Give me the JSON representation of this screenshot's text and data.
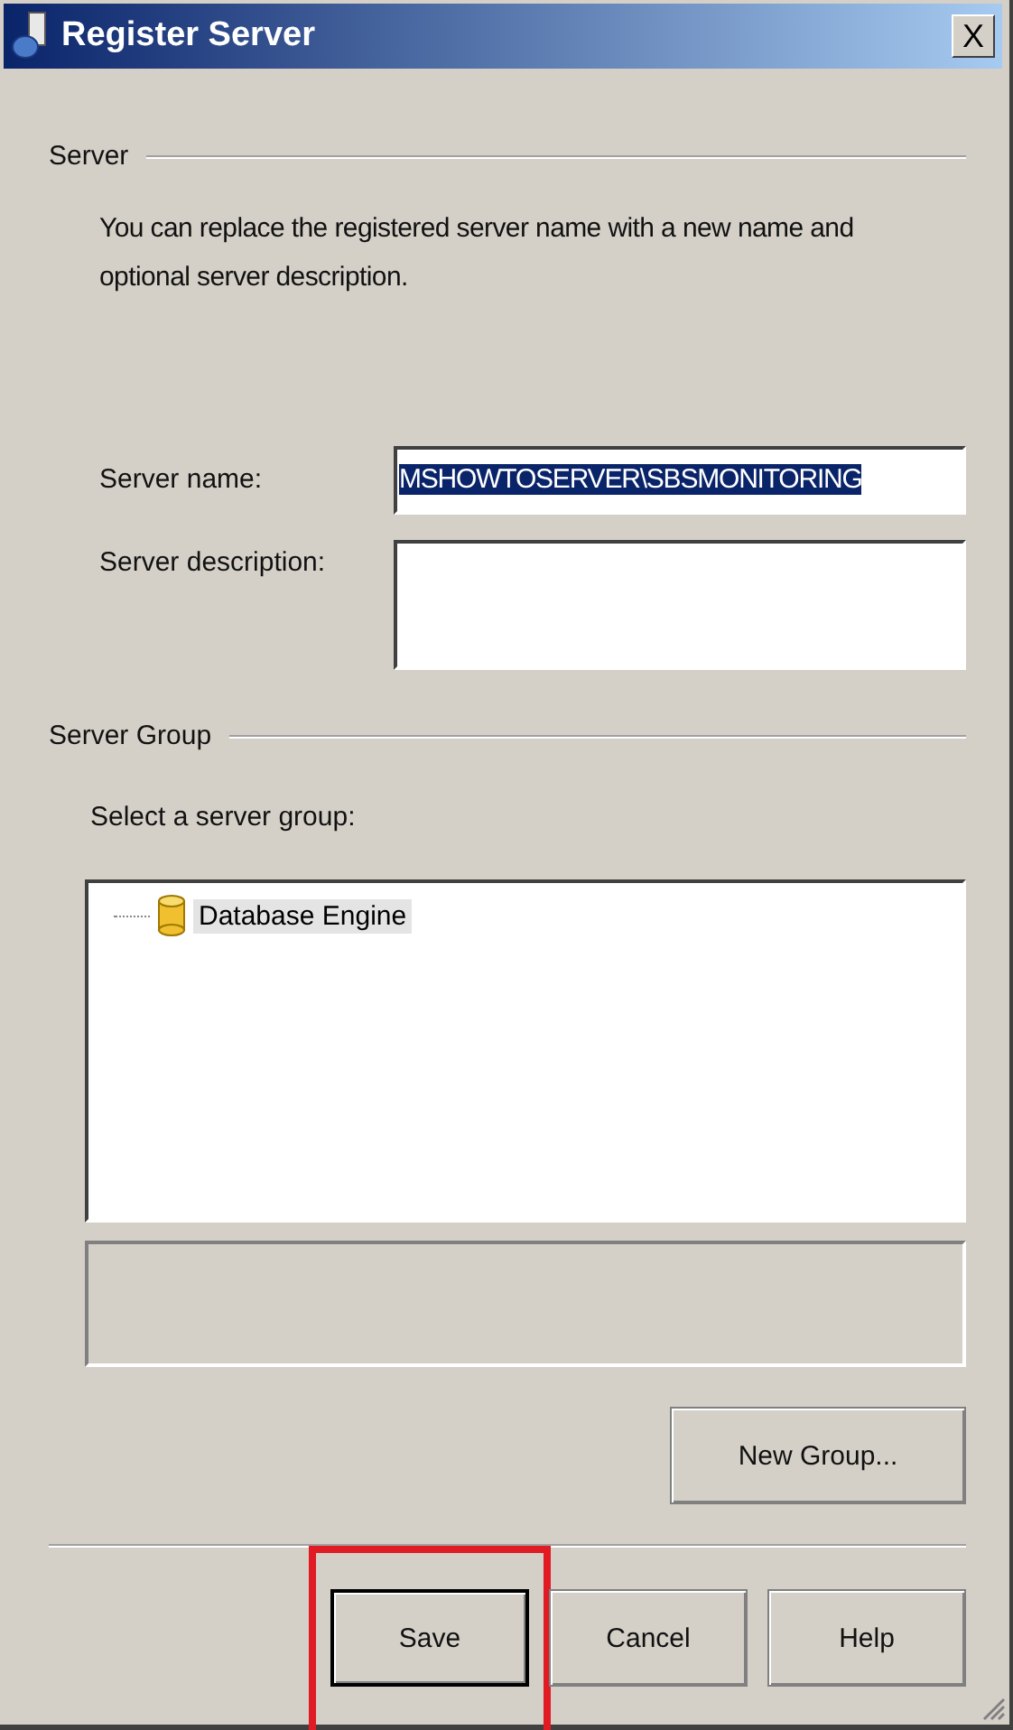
{
  "window": {
    "title": "Register Server",
    "close": "X"
  },
  "server_section": {
    "heading": "Server",
    "description": "You can replace the registered server name with a new name and optional server description.",
    "fields": [
      {
        "label": "Server name:",
        "value": "MSHOWTOSERVER\\SBSMONITORING",
        "selected_text": true,
        "multiline": false
      },
      {
        "label": "Server description:",
        "multiline": true
      }
    ]
  },
  "server_group_section": {
    "heading": "Server Group",
    "label": "Select a server group:",
    "tree": [
      {
        "label": "Database Engine",
        "selected": true
      }
    ],
    "new_group_button": "New Group..."
  },
  "buttons": [
    {
      "label": "Save",
      "default": true,
      "highlighted": true
    },
    {
      "label": "Cancel",
      "default": false,
      "highlighted": false
    },
    {
      "label": "Help",
      "default": false,
      "highlighted": false
    }
  ]
}
